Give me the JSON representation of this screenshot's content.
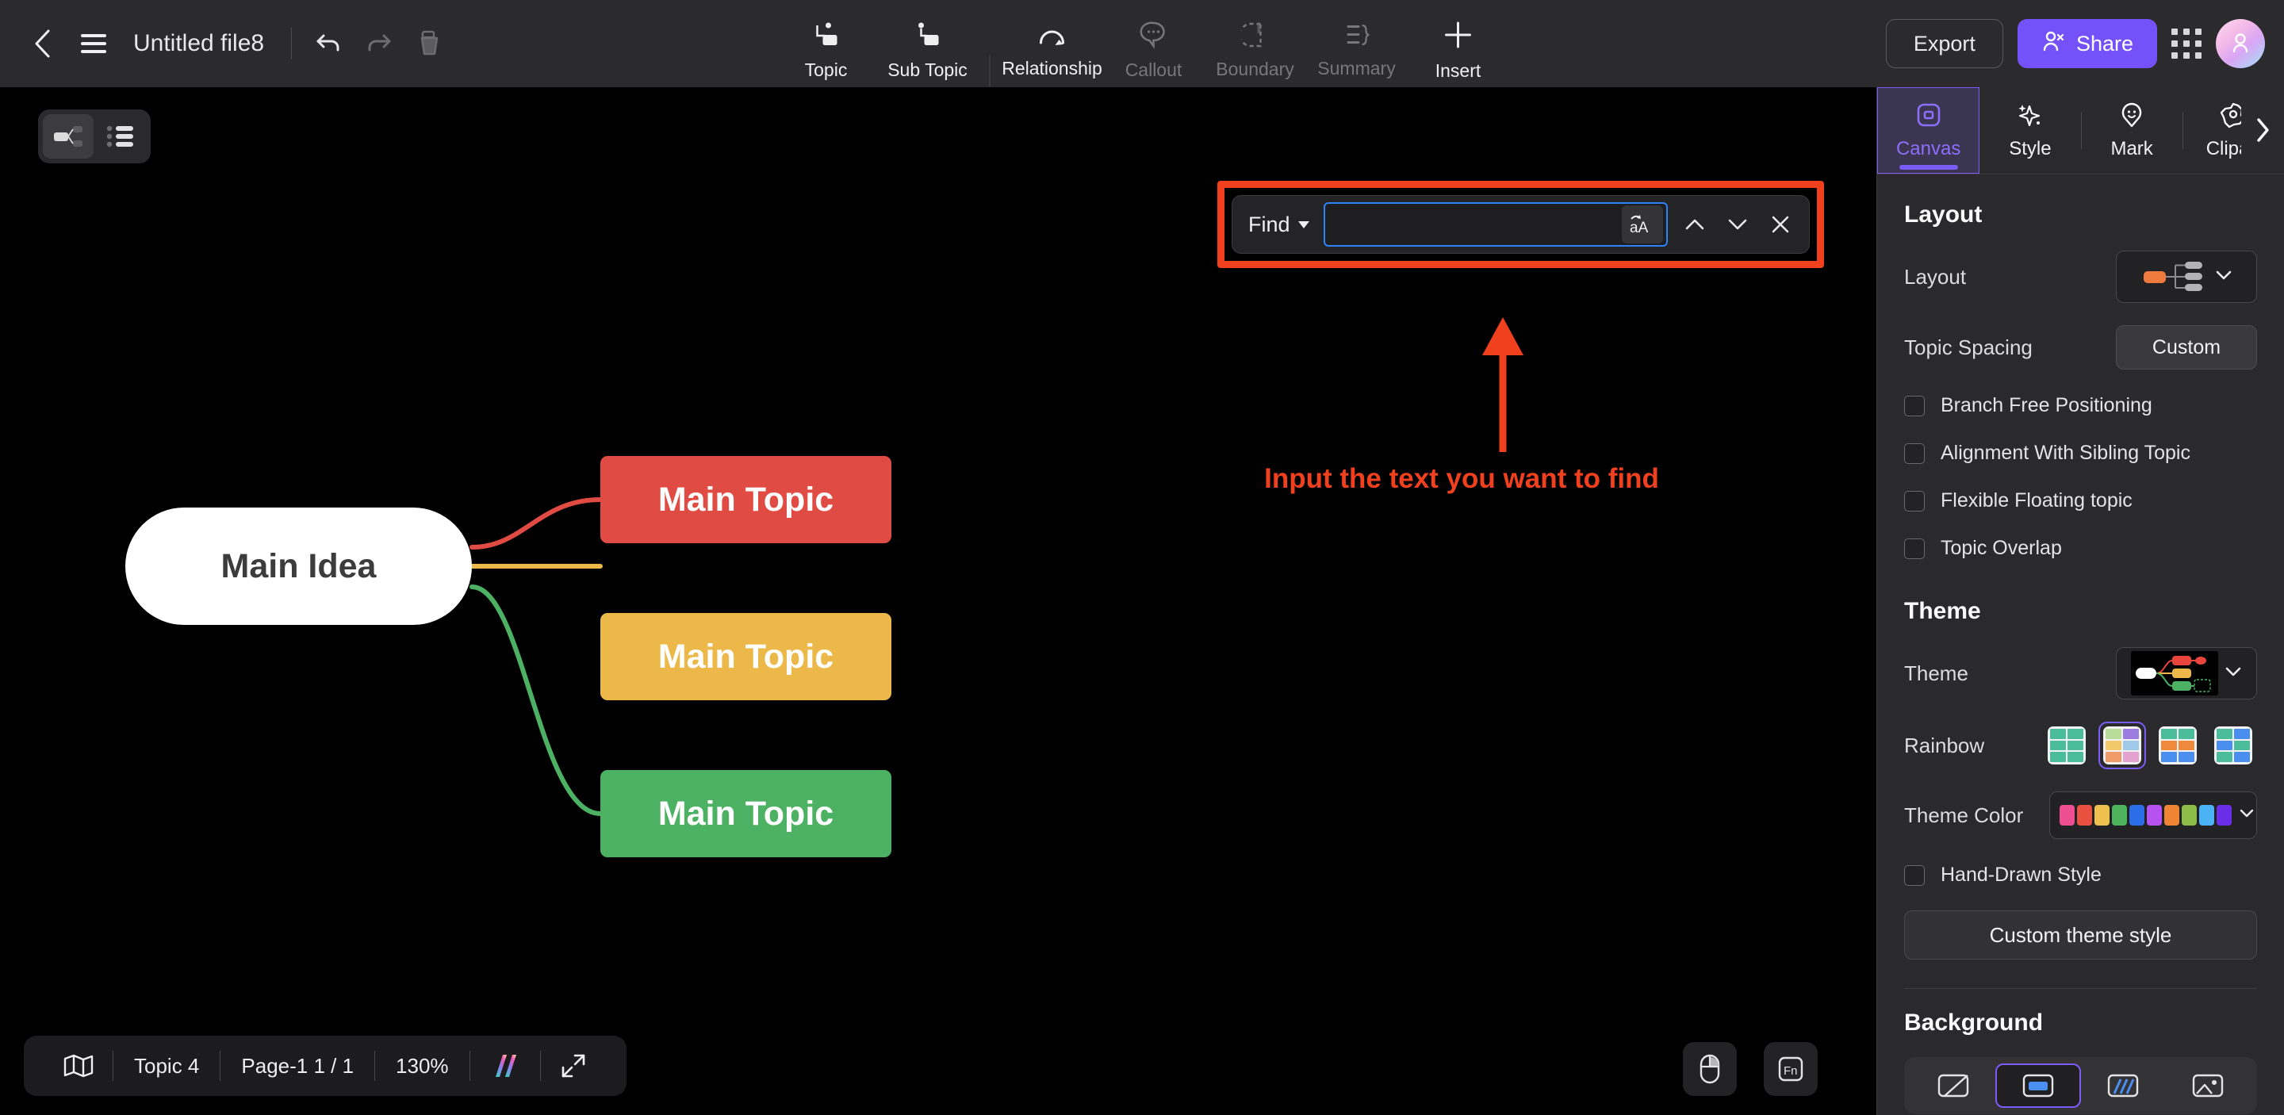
{
  "topbar": {
    "back_label": "Back",
    "menu_label": "Menu",
    "doc_title": "Untitled file8",
    "undo_label": "Undo",
    "redo_label": "Redo",
    "format_painter_label": "Format Painter",
    "tools": [
      {
        "label": "Topic",
        "icon": "topic-icon",
        "enabled": true
      },
      {
        "label": "Sub Topic",
        "icon": "sub-topic-icon",
        "enabled": true
      },
      {
        "label": "Relationship",
        "icon": "relationship-icon",
        "enabled": true
      },
      {
        "label": "Callout",
        "icon": "callout-icon",
        "enabled": false
      },
      {
        "label": "Boundary",
        "icon": "boundary-icon",
        "enabled": false
      },
      {
        "label": "Summary",
        "icon": "summary-icon",
        "enabled": false
      },
      {
        "label": "Insert",
        "icon": "plus-icon",
        "enabled": true
      }
    ],
    "export_label": "Export",
    "share_label": "Share",
    "apps_label": "Apps",
    "avatar_label": "Account"
  },
  "view_toggle": {
    "mindmap_label": "Mind Map View",
    "outline_label": "Outline View",
    "active": "mindmap"
  },
  "find": {
    "mode_label": "Find",
    "input_value": "",
    "input_placeholder": "",
    "case_icon_label": "aA",
    "prev_label": "Previous match",
    "next_label": "Next match",
    "close_label": "Close"
  },
  "annotation": {
    "text": "Input the text you want to find",
    "color": "#f0401e"
  },
  "mindmap": {
    "root": {
      "label": "Main Idea",
      "color": "#ffffff",
      "text_color": "#3c3c3c"
    },
    "topics": [
      {
        "label": "Main Topic",
        "color": "#e04b43"
      },
      {
        "label": "Main Topic",
        "color": "#edb84a"
      },
      {
        "label": "Main Topic",
        "color": "#4cb162"
      }
    ]
  },
  "statusbar": {
    "map_label": "Mini Map",
    "topic_count": "Topic 4",
    "page": "Page-1  1 / 1",
    "zoom": "130%",
    "ai_label": "AI",
    "fullscreen_label": "Fit to screen",
    "mouse_label": "Mouse Mode",
    "fn_label": "Fn"
  },
  "panel": {
    "collapse_label": "Collapse panel",
    "tabs": [
      {
        "label": "Canvas",
        "icon": "canvas-icon",
        "active": true
      },
      {
        "label": "Style",
        "icon": "sparkle-icon",
        "active": false
      },
      {
        "label": "Mark",
        "icon": "mark-icon",
        "active": false
      },
      {
        "label": "Clipart",
        "icon": "clipart-icon",
        "active": false
      }
    ],
    "layout": {
      "section_title": "Layout",
      "layout_label": "Layout",
      "layout_value": "Right Logic Chart",
      "topic_spacing_label": "Topic Spacing",
      "topic_spacing_value": "Custom",
      "checkboxes": [
        {
          "label": "Branch Free Positioning",
          "checked": false
        },
        {
          "label": "Alignment With Sibling Topic",
          "checked": false
        },
        {
          "label": "Flexible Floating topic",
          "checked": false
        },
        {
          "label": "Topic Overlap",
          "checked": false
        }
      ]
    },
    "theme": {
      "section_title": "Theme",
      "theme_label": "Theme",
      "theme_value": "Dark Classic",
      "rainbow_label": "Rainbow",
      "rainbow_selected_index": 1,
      "rainbow_options": [
        {
          "name": "mono-green",
          "colors": [
            "#4cbd9a",
            "#4cbd9a",
            "#4cbd9a",
            "#4cbd9a",
            "#4cbd9a",
            "#4cbd9a"
          ]
        },
        {
          "name": "pastel-mix",
          "colors": [
            "#b8dd9a",
            "#9b7ce0",
            "#f2c96a",
            "#9ec9e8",
            "#f09a6a",
            "#e3a2cf"
          ]
        },
        {
          "name": "green-orange",
          "colors": [
            "#4cbd9a",
            "#4cbd9a",
            "#ef8a3c",
            "#ef8a3c",
            "#4a8ef0",
            "#4a8ef0"
          ]
        },
        {
          "name": "green-blue",
          "colors": [
            "#4cbd9a",
            "#4a8ef0",
            "#4a8ef0",
            "#4cbd9a",
            "#4cbd9a",
            "#4a8ef0"
          ]
        }
      ],
      "theme_color_label": "Theme Color",
      "theme_colors": [
        "#ee4f92",
        "#e8503f",
        "#eec04e",
        "#4eb45c",
        "#2c6ee8",
        "#b552f0",
        "#ef8432",
        "#8dbd48",
        "#4bb2f5",
        "#6a2ee8"
      ],
      "hand_drawn_label": "Hand-Drawn Style",
      "hand_drawn_checked": false,
      "custom_theme_label": "Custom theme style"
    },
    "background": {
      "section_title": "Background",
      "options": [
        {
          "name": "color-fill",
          "selected": false
        },
        {
          "name": "solid",
          "selected": true
        },
        {
          "name": "stripes",
          "selected": false
        },
        {
          "name": "image",
          "selected": false
        }
      ]
    }
  }
}
